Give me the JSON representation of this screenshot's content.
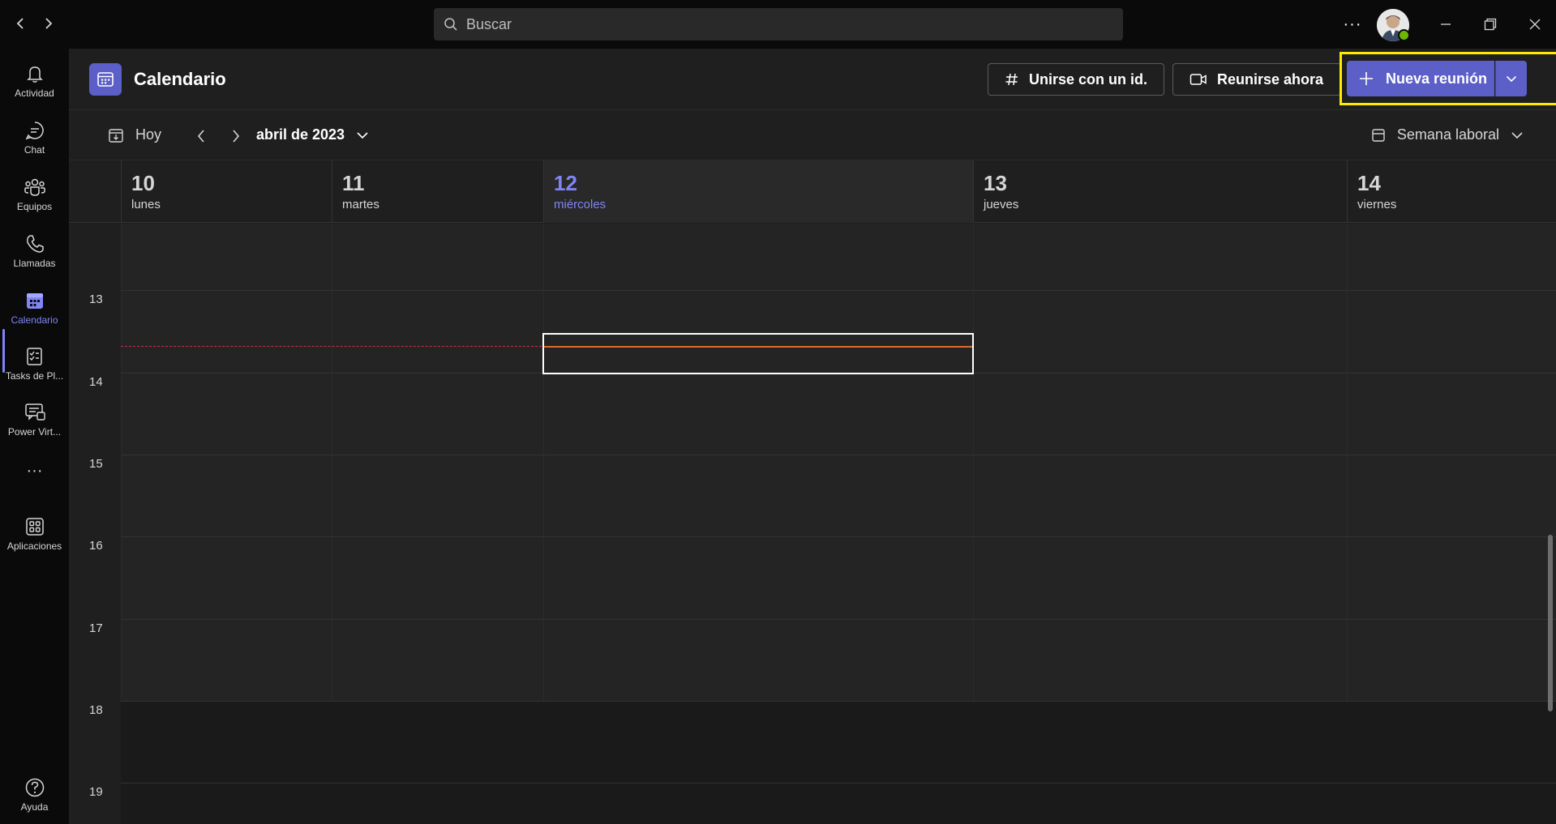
{
  "titlebar": {
    "search_placeholder": "Buscar",
    "more_label": "···",
    "status_color": "#6bb700"
  },
  "rail": {
    "items": [
      {
        "label": "Actividad",
        "icon": "bell-icon"
      },
      {
        "label": "Chat",
        "icon": "chat-icon"
      },
      {
        "label": "Equipos",
        "icon": "teams-icon"
      },
      {
        "label": "Llamadas",
        "icon": "phone-icon"
      },
      {
        "label": "Calendario",
        "icon": "calendar-icon",
        "active": true
      },
      {
        "label": "Tasks de Pl...",
        "icon": "tasks-icon"
      },
      {
        "label": "Power Virt...",
        "icon": "power-virtual-agents-icon"
      },
      {
        "label": "Aplicaciones",
        "icon": "apps-icon"
      },
      {
        "label": "Ayuda",
        "icon": "help-icon"
      }
    ],
    "more_label": "···",
    "accent_color": "#7f85f5"
  },
  "header": {
    "title": "Calendario",
    "join_label": "Unirse con un id.",
    "meet_now_label": "Reunirse ahora",
    "new_meeting_label": "Nueva reunión",
    "brand_color": "#5b5fc7",
    "highlight_color": "#ffeb00"
  },
  "toolbar": {
    "today_label": "Hoy",
    "month_label": "abril de 2023",
    "view_label": "Semana laboral"
  },
  "days": [
    {
      "num": "10",
      "name": "lunes"
    },
    {
      "num": "11",
      "name": "martes"
    },
    {
      "num": "12",
      "name": "miércoles",
      "today": true
    },
    {
      "num": "13",
      "name": "jueves"
    },
    {
      "num": "14",
      "name": "viernes"
    }
  ],
  "hours": [
    "13",
    "14",
    "15",
    "16",
    "17",
    "18",
    "19"
  ]
}
